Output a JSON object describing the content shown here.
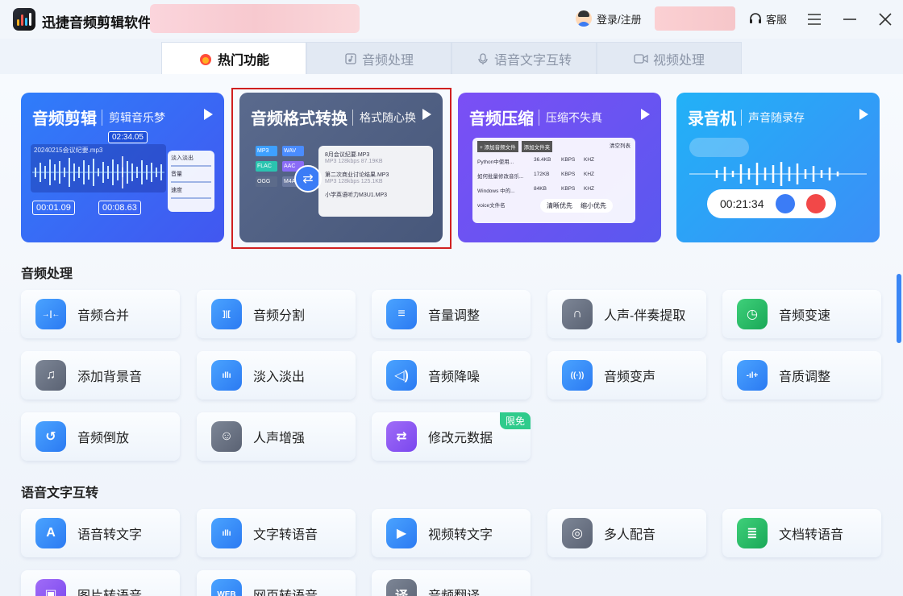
{
  "app": {
    "title": "迅捷音频剪辑软件",
    "login": "登录/注册",
    "service": "客服"
  },
  "tabs": [
    {
      "label": "热门功能",
      "icon": "fire-icon"
    },
    {
      "label": "音频处理",
      "icon": "music-file-icon"
    },
    {
      "label": "语音文字互转",
      "icon": "mic-icon"
    },
    {
      "label": "视频处理",
      "icon": "video-icon"
    }
  ],
  "cards": [
    {
      "title": "音频剪辑",
      "subtitle": "剪辑音乐梦",
      "time_marker": "02:34.05",
      "file": "20240215会议纪要.mp3",
      "start": "00:01.09",
      "end": "00:08.63",
      "side": [
        "淡入淡出",
        "音量",
        "速度"
      ]
    },
    {
      "title": "音频格式转换",
      "subtitle": "格式随心换",
      "formats": [
        "MP3",
        "WAV",
        "FLAC",
        "AAC",
        "OGG",
        "M4A"
      ],
      "files": [
        {
          "name": "8月会议纪要.MP3",
          "meta": "MP3   128kbps   87.19KB"
        },
        {
          "name": "第二次商业讨论结果.MP3",
          "meta": "MP3   128kbps   125.1KB"
        },
        {
          "name": "小学英语听力M3U1.MP3",
          "meta": ""
        }
      ]
    },
    {
      "title": "音频压缩",
      "subtitle": "压缩不失真",
      "buttons": [
        "+ 添加音频文件",
        "添加文件夹",
        "清空列表"
      ],
      "rows": [
        {
          "name": "Python中使用...",
          "size": "36.4KB",
          "unit": "KBPS",
          "hz": "KHZ"
        },
        {
          "name": "如何批量修改音乐...",
          "size": "172KB",
          "unit": "KBPS",
          "hz": "KHZ"
        },
        {
          "name": "Windows 中的...",
          "size": "84KB",
          "unit": "KBPS",
          "hz": "KHZ"
        },
        {
          "name": "voice文件名",
          "size": "",
          "unit": "",
          "hz": ""
        }
      ],
      "options": [
        "清晰优先",
        "缩小优先"
      ]
    },
    {
      "title": "录音机",
      "subtitle": "声音随录存",
      "timer": "00:21:34"
    }
  ],
  "sections": [
    {
      "title": "音频处理",
      "items": [
        {
          "label": "音频合并",
          "icon": "merge-icon",
          "color": "blue",
          "glyph": "→|←"
        },
        {
          "label": "音频分割",
          "icon": "split-icon",
          "color": "blue",
          "glyph": "]|["
        },
        {
          "label": "音量调整",
          "icon": "sliders-icon",
          "color": "blue",
          "glyph": "≡"
        },
        {
          "label": "人声-伴奏提取",
          "icon": "headphones-icon",
          "color": "gray",
          "glyph": "∩"
        },
        {
          "label": "音频变速",
          "icon": "speed-icon",
          "color": "green",
          "glyph": "◷"
        },
        {
          "label": "添加背景音",
          "icon": "music-note-icon",
          "color": "gray",
          "glyph": "♫"
        },
        {
          "label": "淡入淡出",
          "icon": "bars-icon",
          "color": "blue",
          "glyph": "ıllı"
        },
        {
          "label": "音频降噪",
          "icon": "speaker-icon",
          "color": "blue",
          "glyph": "◁)"
        },
        {
          "label": "音频变声",
          "icon": "voice-wave-icon",
          "color": "blue",
          "glyph": "((·))"
        },
        {
          "label": "音质调整",
          "icon": "quality-icon",
          "color": "blue",
          "glyph": "-ıl+"
        },
        {
          "label": "音频倒放",
          "icon": "rewind-icon",
          "color": "blue",
          "glyph": "↺"
        },
        {
          "label": "人声增强",
          "icon": "person-voice-icon",
          "color": "gray",
          "glyph": "☺"
        },
        {
          "label": "修改元数据",
          "icon": "metadata-icon",
          "color": "purple",
          "glyph": "⇄",
          "badge": "限免"
        }
      ]
    },
    {
      "title": "语音文字互转",
      "items": [
        {
          "label": "语音转文字",
          "icon": "letter-a-icon",
          "color": "blue",
          "glyph": "A"
        },
        {
          "label": "文字转语音",
          "icon": "wave-icon",
          "color": "blue",
          "glyph": "ıllı"
        },
        {
          "label": "视频转文字",
          "icon": "video-play-icon",
          "color": "blue",
          "glyph": "▶"
        },
        {
          "label": "多人配音",
          "icon": "multi-voice-icon",
          "color": "gray",
          "glyph": "◎"
        },
        {
          "label": "文档转语音",
          "icon": "document-icon",
          "color": "green",
          "glyph": "≣"
        },
        {
          "label": "图片转语音",
          "icon": "image-icon",
          "color": "purple",
          "glyph": "▣"
        },
        {
          "label": "网页转语音",
          "icon": "web-icon",
          "color": "blue",
          "glyph": "WEB"
        },
        {
          "label": "音频翻译",
          "icon": "translate-icon",
          "color": "gray",
          "glyph": "译"
        }
      ]
    }
  ]
}
